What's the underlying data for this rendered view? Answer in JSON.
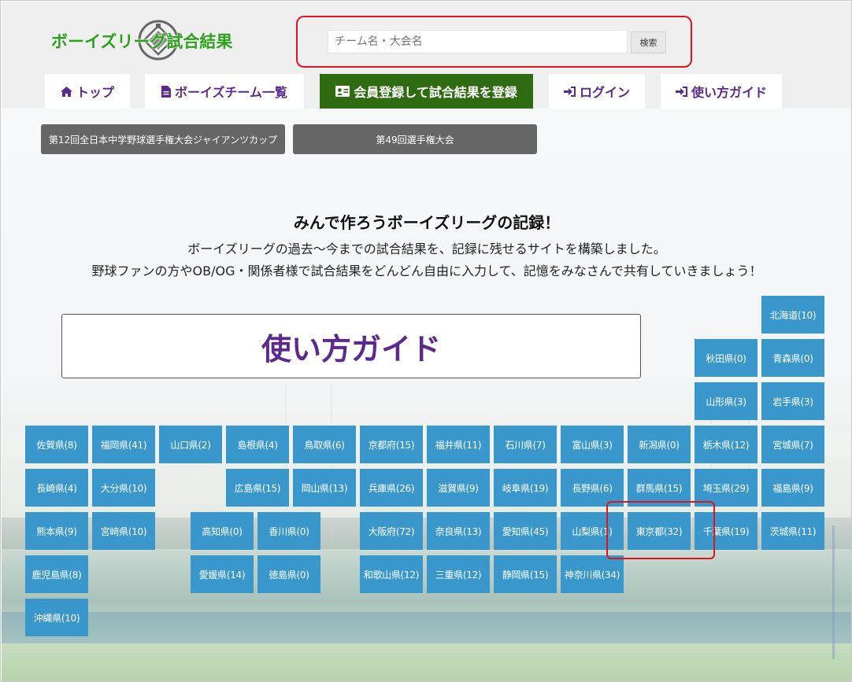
{
  "logo": {
    "text": "ボーイズリーグ試合結果"
  },
  "search": {
    "placeholder": "チーム名・大会名",
    "button_label": "検索"
  },
  "nav": {
    "top": "トップ",
    "teams": "ボーイズチーム一覧",
    "register": "会員登録して試合結果を登録",
    "login": "ログイン",
    "guide": "使い方ガイド"
  },
  "tournaments": [
    "第12回全日本中学野球選手権大会ジャイアンツカップ",
    "第49回選手権大会"
  ],
  "intro": {
    "title": "みんで作ろうボーイズリーグの記録！",
    "line1": "ボーイズリーグの過去〜今までの試合結果を、記録に残せるサイトを構築しました。",
    "line2": "野球ファンの方やOB/OG・関係者様で試合結果をどんどん自由に入力して、記憶をみなさんで共有していきましょう！"
  },
  "guide_box": {
    "label": "使い方ガイド"
  },
  "colors": {
    "accent_purple": "#5c2a8f",
    "register_green": "#2f6b11",
    "tile_blue": "#3a97cc",
    "highlight_red": "#e0141c",
    "logo_green": "#2aa219"
  },
  "prefectures": [
    {
      "id": "hokkaido",
      "label": "北海道(10)"
    },
    {
      "id": "akita",
      "label": "秋田県(0)"
    },
    {
      "id": "aomori",
      "label": "青森県(0)"
    },
    {
      "id": "yamagata",
      "label": "山形県(3)"
    },
    {
      "id": "iwate",
      "label": "岩手県(3)"
    },
    {
      "id": "saga",
      "label": "佐賀県(8)"
    },
    {
      "id": "fukuoka",
      "label": "福岡県(41)"
    },
    {
      "id": "yamaguchi",
      "label": "山口県(2)"
    },
    {
      "id": "shimane",
      "label": "島根県(4)"
    },
    {
      "id": "tottori",
      "label": "鳥取県(6)"
    },
    {
      "id": "kyoto",
      "label": "京都府(15)"
    },
    {
      "id": "fukui",
      "label": "福井県(11)"
    },
    {
      "id": "ishikawa",
      "label": "石川県(7)"
    },
    {
      "id": "toyama",
      "label": "富山県(3)"
    },
    {
      "id": "niigata",
      "label": "新潟県(0)"
    },
    {
      "id": "tochigi",
      "label": "栃木県(12)"
    },
    {
      "id": "miyagi",
      "label": "宮城県(7)"
    },
    {
      "id": "nagasaki",
      "label": "長崎県(4)"
    },
    {
      "id": "oita",
      "label": "大分県(10)"
    },
    {
      "id": "hiroshima",
      "label": "広島県(15)"
    },
    {
      "id": "okayama",
      "label": "岡山県(13)"
    },
    {
      "id": "hyogo",
      "label": "兵庫県(26)"
    },
    {
      "id": "shiga",
      "label": "滋賀県(9)"
    },
    {
      "id": "gifu",
      "label": "岐阜県(19)"
    },
    {
      "id": "nagano",
      "label": "長野県(6)"
    },
    {
      "id": "gunma",
      "label": "群馬県(15)"
    },
    {
      "id": "saitama",
      "label": "埼玉県(29)"
    },
    {
      "id": "fukushima",
      "label": "福島県(9)"
    },
    {
      "id": "kumamoto",
      "label": "熊本県(9)"
    },
    {
      "id": "miyazaki",
      "label": "宮崎県(10)"
    },
    {
      "id": "kochi",
      "label": "高知県(0)"
    },
    {
      "id": "kagawa",
      "label": "香川県(0)"
    },
    {
      "id": "osaka",
      "label": "大阪府(72)"
    },
    {
      "id": "nara",
      "label": "奈良県(13)"
    },
    {
      "id": "aichi",
      "label": "愛知県(45)"
    },
    {
      "id": "yamanashi",
      "label": "山梨県(1)"
    },
    {
      "id": "tokyo",
      "label": "東京都(32)"
    },
    {
      "id": "chiba",
      "label": "千葉県(19)"
    },
    {
      "id": "ibaraki",
      "label": "茨城県(11)"
    },
    {
      "id": "kagoshima",
      "label": "鹿児島県(8)"
    },
    {
      "id": "ehime",
      "label": "愛媛県(14)"
    },
    {
      "id": "tokushima",
      "label": "徳島県(0)"
    },
    {
      "id": "wakayama",
      "label": "和歌山県(12)"
    },
    {
      "id": "mie",
      "label": "三重県(12)"
    },
    {
      "id": "shizuoka",
      "label": "静岡県(15)"
    },
    {
      "id": "kanagawa",
      "label": "神奈川県(34)"
    },
    {
      "id": "okinawa",
      "label": "沖縄県(10)"
    }
  ]
}
